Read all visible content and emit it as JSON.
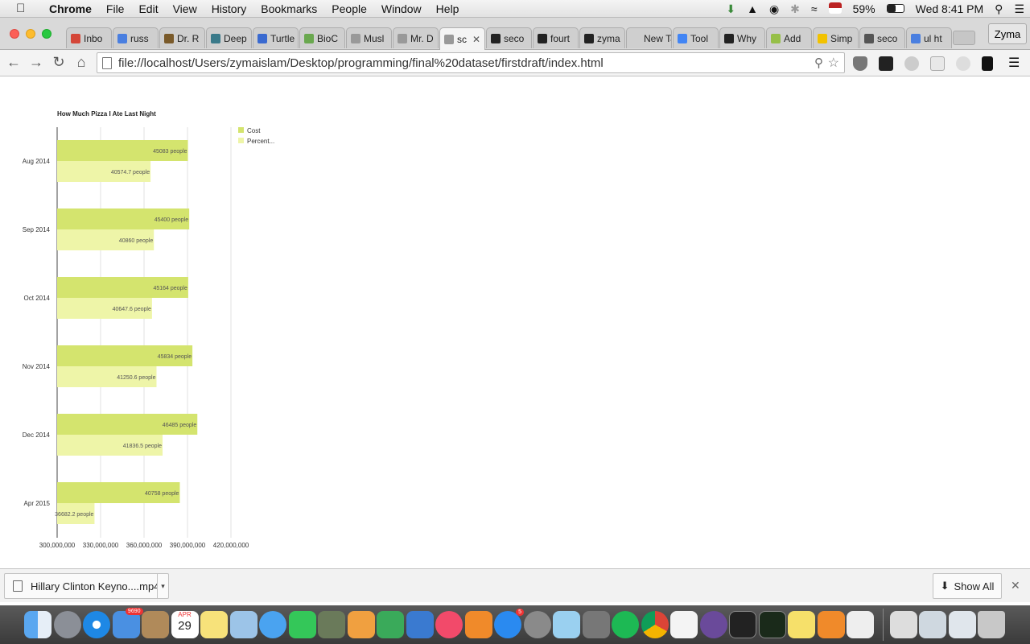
{
  "menubar": {
    "app": "Chrome",
    "items": [
      "File",
      "Edit",
      "View",
      "History",
      "Bookmarks",
      "People",
      "Window",
      "Help"
    ],
    "battery": "59%",
    "clock": "Wed 8:41 PM"
  },
  "tabs": [
    {
      "label": "Inbo",
      "color": "#d44638"
    },
    {
      "label": "russ",
      "color": "#4a7fe0"
    },
    {
      "label": "Dr. R",
      "color": "#7a5a2a"
    },
    {
      "label": "Deep",
      "color": "#3a7a8a"
    },
    {
      "label": "Turtle",
      "color": "#3a6ad0"
    },
    {
      "label": "BioC",
      "color": "#6aa84f"
    },
    {
      "label": "Musl",
      "color": "#999999"
    },
    {
      "label": "Mr. D",
      "color": "#999999"
    },
    {
      "label": "sc",
      "color": "#999999",
      "active": true
    },
    {
      "label": "seco",
      "color": "#222222"
    },
    {
      "label": "fourt",
      "color": "#222222"
    },
    {
      "label": "zyma",
      "color": "#222222"
    },
    {
      "label": "New Tab",
      "color": "#cfcfcf"
    },
    {
      "label": "Tool",
      "color": "#4285f4"
    },
    {
      "label": "Why",
      "color": "#222222"
    },
    {
      "label": "Add",
      "color": "#96bf48"
    },
    {
      "label": "Simp",
      "color": "#f2c200"
    },
    {
      "label": "seco",
      "color": "#555555"
    },
    {
      "label": "ul ht",
      "color": "#4a7fe0"
    }
  ],
  "profile_name": "Zyma",
  "address": {
    "url": "file://localhost/Users/zymaislam/Desktop/programming/final%20dataset/firstdraft/index.html"
  },
  "chart_data": {
    "type": "bar",
    "orientation": "horizontal",
    "title": "How Much Pizza I Ate Last Night",
    "categories": [
      "Aug 2014",
      "Sep 2014",
      "Oct 2014",
      "Nov 2014",
      "Dec 2014",
      "Apr 2015"
    ],
    "series": [
      {
        "name": "Cost",
        "color": "#d4e46e",
        "values": [
          390300000,
          391200000,
          390500000,
          393400000,
          396800000,
          384700000
        ],
        "labels": [
          "45083 people",
          "45400 people",
          "45164 people",
          "45834 people",
          "46485 people",
          "40758 people"
        ]
      },
      {
        "name": "Percent...",
        "color": "#eef5a8",
        "values": [
          364500000,
          366800000,
          365500000,
          368600000,
          372800000,
          325800000
        ],
        "labels": [
          "40574.7 people",
          "40860 people",
          "40647.6 people",
          "41250.6 people",
          "41836.5 people",
          "36682.2 people"
        ]
      }
    ],
    "xlim": [
      300000000,
      420000000
    ],
    "xticks": [
      "300,000,000",
      "330,000,000",
      "360,000,000",
      "390,000,000",
      "420,000,000"
    ],
    "grid": true,
    "legend_position": "top-right"
  },
  "download": {
    "filename": "Hillary Clinton Keyno....mp4",
    "show_all": "Show All"
  },
  "dock": {
    "badges": {
      "mail": "9690",
      "appstore": "5"
    },
    "calendar_month": "APR",
    "calendar_day": "29"
  }
}
